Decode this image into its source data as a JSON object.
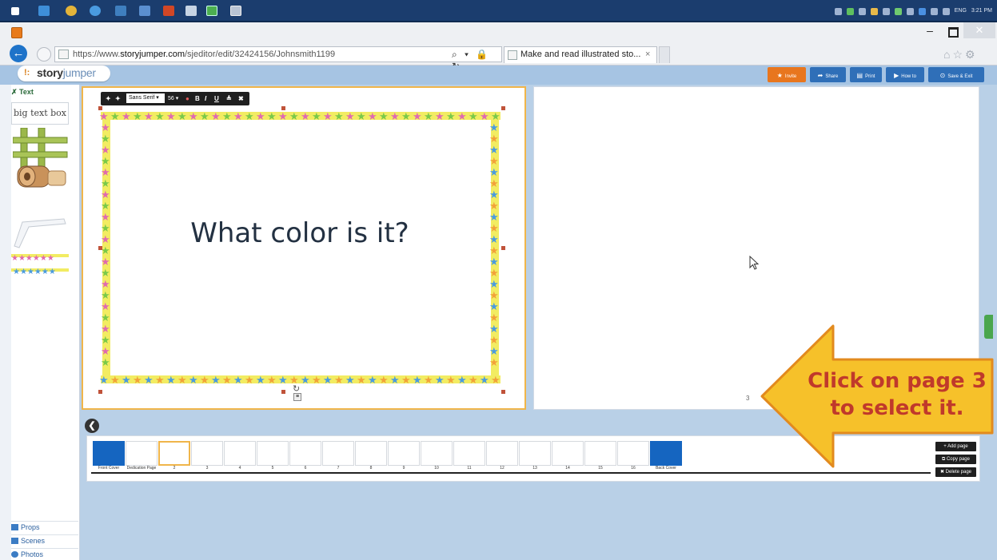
{
  "taskbar": {
    "icons": [
      "windows-icon",
      "media-icon",
      "chrome-icon",
      "ie-icon",
      "folder-icon",
      "app-icon",
      "powerpoint-icon",
      "word-icon",
      "excel-icon",
      "camtasia-icon"
    ],
    "lang": "ENG",
    "clock": "3:21 PM"
  },
  "browser": {
    "url_prefix": "https://www.",
    "url_host": "storyjumper.com",
    "url_path": "/sjeditor/edit/32424156/Johnsmith1199",
    "tab_title": "Make and read illustrated sto...",
    "tab_close": "×",
    "addr_tools": "⌕ ▾ 🔒 ↻",
    "win_min": "–",
    "win_close": "✕",
    "back_glyph": "←",
    "nav_glyphs": "⌂☆⚙"
  },
  "header": {
    "logo_mark": "!:",
    "logo_bold": "story",
    "logo_light": "jumper",
    "buttons": [
      {
        "label": "Invite",
        "icon": "★",
        "color": "#e8761e"
      },
      {
        "label": "Share",
        "icon": "➦",
        "color": "#2f6fb8"
      },
      {
        "label": "Print",
        "icon": "▤",
        "color": "#2f6fb8"
      },
      {
        "label": "How to",
        "icon": "▶",
        "color": "#2f6fb8"
      },
      {
        "label": "Save & Exit",
        "icon": "⊙",
        "color": "#2f6fb8"
      }
    ]
  },
  "left_panel": {
    "active_tab": "✗ Text",
    "text_item": "big text box",
    "categories": [
      "Props",
      "Scenes",
      "Photos"
    ]
  },
  "text_toolbar": {
    "arrow_up": "✦",
    "arrow_down": "✦",
    "font": "Sans Serif ▾",
    "size": "56 ▾",
    "icons": [
      "●",
      "B",
      "I",
      "U",
      "≜",
      "✖"
    ]
  },
  "page": {
    "heading": "What color is it?",
    "right_page_number": "3",
    "rotate_glyph": "↻",
    "small_handle_glyph": "≡"
  },
  "strip": {
    "collapse_glyph": "❮",
    "thumbs": [
      {
        "label": "Front Cover",
        "kind": "cover"
      },
      {
        "label": "Dedication Page",
        "kind": "dedication"
      },
      {
        "label": "2",
        "kind": "selected"
      },
      {
        "label": "3",
        "kind": "blank"
      },
      {
        "label": "4",
        "kind": "blank"
      },
      {
        "label": "5",
        "kind": "blank"
      },
      {
        "label": "6",
        "kind": "blank"
      },
      {
        "label": "7",
        "kind": "blank"
      },
      {
        "label": "8",
        "kind": "blank"
      },
      {
        "label": "9",
        "kind": "blank"
      },
      {
        "label": "10",
        "kind": "blank"
      },
      {
        "label": "11",
        "kind": "blank"
      },
      {
        "label": "12",
        "kind": "blank"
      },
      {
        "label": "13",
        "kind": "blank"
      },
      {
        "label": "14",
        "kind": "blank"
      },
      {
        "label": "15",
        "kind": "blank"
      },
      {
        "label": "16",
        "kind": "blank"
      },
      {
        "label": "Back Cover",
        "kind": "cover"
      }
    ],
    "add_page": "+ Add page",
    "copy_page": "⧉ Copy page",
    "delete_page": "✖ Delete page"
  },
  "callout": {
    "line1": "Click on page 3",
    "line2": "to select it.",
    "fill": "#f6c12a",
    "stroke": "#e28a1e",
    "text_color": "#c0392b"
  },
  "colors": {
    "cover_blue": "#1565c0",
    "selected_page_border": "#f0b54a",
    "workspace": "#b9d0e7"
  }
}
